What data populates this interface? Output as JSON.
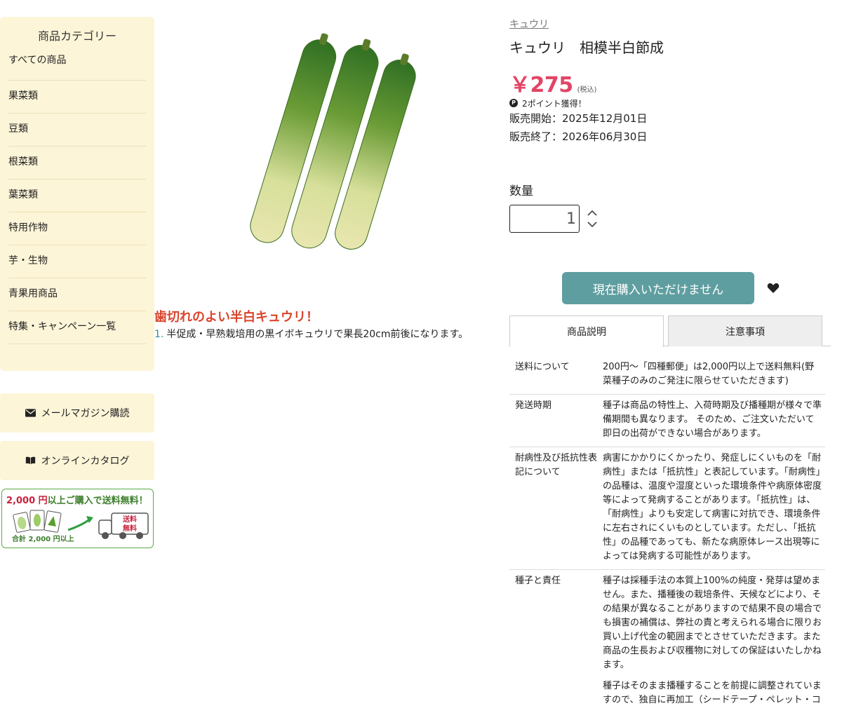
{
  "sidebar": {
    "category_title": "商品カテゴリー",
    "categories": [
      {
        "label": "すべての商品"
      },
      {
        "label": "果菜類"
      },
      {
        "label": "豆類"
      },
      {
        "label": "根菜類"
      },
      {
        "label": "葉菜類"
      },
      {
        "label": "特用作物"
      },
      {
        "label": "芋・生物"
      },
      {
        "label": "青果用商品"
      },
      {
        "label": "特集・キャンペーン一覧"
      }
    ],
    "mail_magazine_label": "メールマガジン購読",
    "online_catalog_label": "オンラインカタログ",
    "shipping_banner": {
      "amount": "2,000 円",
      "text": "以上ご購入で送料無料！",
      "total_label": "合計 2,000 円以上",
      "truck_label_1": "送料",
      "truck_label_2": "無料"
    }
  },
  "product": {
    "breadcrumb": "キュウリ",
    "title": "キュウリ　相模半白節成",
    "price": "￥275",
    "tax_note": "(税込)",
    "points": "2ポイント獲得！",
    "points_icon_letter": "P",
    "sale_start": "販売開始：2025年12月01日",
    "sale_end": "販売終了：2026年06月30日",
    "catch_copy": "歯切れのよい半白キュウリ！",
    "features": [
      {
        "num": "1.",
        "text": "半促成・早熟栽培用の黒イボキュウリで果長20cm前後になります。"
      }
    ]
  },
  "purchase": {
    "quantity_label": "数量",
    "quantity_value": "1",
    "buy_button_label": "現在購入いただけません"
  },
  "tabs": [
    {
      "label": "商品説明",
      "active": true
    },
    {
      "label": "注意事項",
      "active": false
    }
  ],
  "info_rows": [
    {
      "key": "送料について",
      "value": "200円〜「四種郵便」は2,000円以上で送料無料(野菜種子のみのご発注に限らせていただきます)"
    },
    {
      "key": "発送時期",
      "value": "種子は商品の特性上、入荷時期及び播種期が様々で準備期間も異なります。 そのため、ご注文いただいて即日の出荷ができない場合があります。"
    },
    {
      "key": "耐病性及び抵抗性表記について",
      "value": "病害にかかりにくかったり、発症しにくいものを「耐病性」または「抵抗性」と表記しています。「耐病性」の品種は、温度や湿度といった環境条件や病原体密度等によって発病することがあります。「抵抗性」は、「耐病性」よりも安定して病害に対抗でき、環境条件に左右されにくいものとしています。ただし、「抵抗性」の品種であっても、新たな病原体レース出現等によっては発病する可能性があります。"
    },
    {
      "key": "種子と責任",
      "value": "種子は採種手法の本質上100%の純度・発芽は望めません。また、播種後の栽培条件、天候などにより、その結果が異なることがありますので結果不良の場合でも損害の補償は、弊社の責と考えられる場合に限りお買い上げ代金の範囲までとさせていただきます。また商品の生長および収穫物に対しての保証はいたしかねます。",
      "value2": "種子はそのまま播種することを前提に調整されていますので、独自に再加工（シードテープ・ペレット・コ"
    }
  ],
  "colors": {
    "sidebar_bg": "#fdf5d8",
    "price": "#e24566",
    "catch_copy": "#d9452c",
    "buy_button": "#5f9ea0",
    "banner_green": "#3b7d2a",
    "banner_red": "#c8223c"
  },
  "icons": {
    "mail": "envelope-icon",
    "catalog": "book-icon",
    "favorite": "heart-icon",
    "stepper_up": "chevron-up-icon",
    "stepper_down": "chevron-down-icon"
  }
}
